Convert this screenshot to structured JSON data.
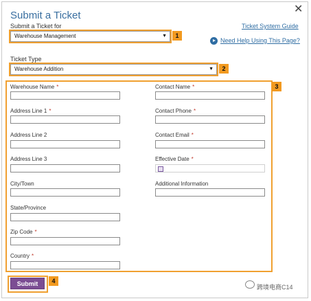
{
  "dialog": {
    "title": "Submit a Ticket",
    "submit_for_label": "Submit a Ticket for",
    "submit_for_value": "Warehouse Management",
    "ticket_type_label": "Ticket Type",
    "ticket_type_value": "Warehouse Addition",
    "guide_link": "Ticket System Guide",
    "help_link": "Need Help Using This Page?",
    "submit_label": "Submit"
  },
  "left_fields": [
    {
      "label": "Warehouse Name",
      "required": "*"
    },
    {
      "label": "Address Line 1",
      "required": "*"
    },
    {
      "label": "Address Line 2",
      "required": ""
    },
    {
      "label": "Address Line 3",
      "required": ""
    },
    {
      "label": "City/Town",
      "required": ""
    },
    {
      "label": "State/Province",
      "required": ""
    },
    {
      "label": "Zip Code",
      "required": "*"
    },
    {
      "label": "Country",
      "required": "*"
    }
  ],
  "right_fields": [
    {
      "label": "Contact Name",
      "required": "*"
    },
    {
      "label": "Contact Phone",
      "required": "*"
    },
    {
      "label": "Contact Email",
      "required": "*"
    },
    {
      "label": "Effective Date",
      "required": "*"
    },
    {
      "label": "Additional Information",
      "required": ""
    }
  ],
  "badges": [
    "1",
    "2",
    "3",
    "4"
  ],
  "watermark": "跨境电商C14",
  "colors": {
    "accent_orange": "#f0a030",
    "title_blue": "#3a6fa0",
    "submit_purple": "#7b4d93"
  }
}
